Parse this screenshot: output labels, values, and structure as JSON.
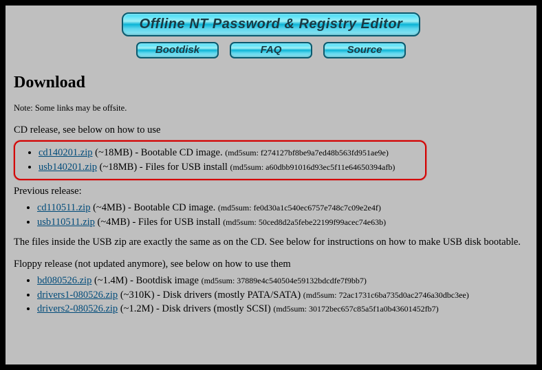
{
  "header": {
    "title": "Offline NT Password & Registry Editor"
  },
  "nav": {
    "bootdisk": "Bootdisk",
    "faq": "FAQ",
    "source": "Source"
  },
  "section": {
    "heading": "Download",
    "note": "Note: Some links may be offsite.",
    "cd_intro": "CD release, see below on how to use",
    "prev_intro": "Previous release:",
    "usb_note": "The files inside the USB zip are exactly the same as on the CD. See below for instructions on how to make USB disk bootable.",
    "floppy_intro": "Floppy release (not updated anymore), see below on how to use them"
  },
  "cd": {
    "item1": {
      "link": "cd140201.zip",
      "tail1": " (~18MB) - Bootable CD image. ",
      "md5": "(md5sum: f274127bf8be9a7ed48b563fd951ae9e)"
    },
    "item2": {
      "link": "usb140201.zip",
      "tail1": " (~18MB) - Files for USB install ",
      "md5": "(md5sum: a60dbb91016d93ec5f11e64650394afb)"
    }
  },
  "prev": {
    "item1": {
      "link": "cd110511.zip",
      "tail1": " (~4MB) - Bootable CD image. ",
      "md5": "(md5sum: fe0d30a1c540ec6757e748c7c09e2e4f)"
    },
    "item2": {
      "link": "usb110511.zip",
      "tail1": " (~4MB) - Files for USB install ",
      "md5": "(md5sum: 50ced8d2a5febe22199f99acec74e63b)"
    }
  },
  "floppy": {
    "item1": {
      "link": "bd080526.zip",
      "tail1": " (~1.4M) - Bootdisk image ",
      "md5": "(md5sum: 37889e4c540504e59132bdcdfe7f9bb7)"
    },
    "item2": {
      "link": "drivers1-080526.zip",
      "tail1": " (~310K) - Disk drivers (mostly PATA/SATA) ",
      "md5": "(md5sum: 72ac1731c6ba735d0ac2746a30dbc3ee)"
    },
    "item3": {
      "link": "drivers2-080526.zip",
      "tail1": " (~1.2M) - Disk drivers (mostly SCSI) ",
      "md5": "(md5sum: 30172bec657c85a5f1a0b43601452fb7)"
    }
  }
}
